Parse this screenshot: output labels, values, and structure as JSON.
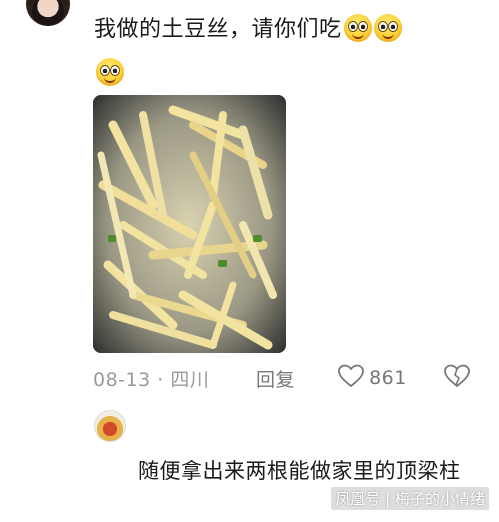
{
  "comment": {
    "text": "我做的土豆丝，请你们吃",
    "emoji_icon": "smiling-face-emoji",
    "emoji_count": 3
  },
  "meta": {
    "date": "08-13",
    "separator": "·",
    "location": "四川",
    "reply_label": "回复",
    "like_count": "861"
  },
  "reply": {
    "text": "随便拿出来两根能做家里的顶梁柱"
  },
  "watermark": {
    "text": "凤凰号 | 梅子的小情绪"
  },
  "colors": {
    "meta_gray": "#9a9a9a",
    "text_black": "#1a1a1a"
  }
}
